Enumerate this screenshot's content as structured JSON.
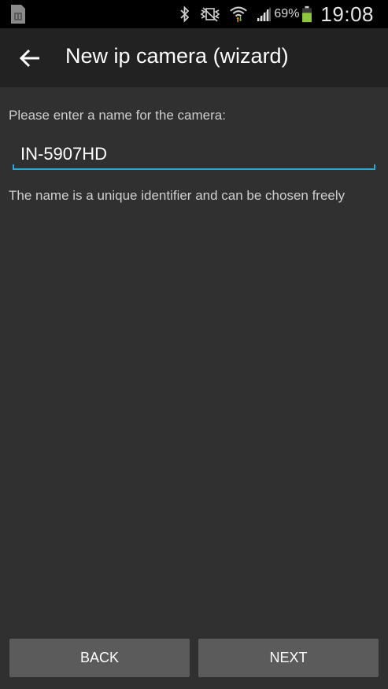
{
  "status_bar": {
    "battery_percent": "69%",
    "time": "19:08",
    "icons": [
      "sim-card-icon",
      "bluetooth-icon",
      "vibrate-icon",
      "wifi-icon",
      "signal-icon",
      "battery-icon"
    ],
    "battery_color": "#8dc63f",
    "wifi_arrow_colors": [
      "#f5a623",
      "#8dc63f"
    ]
  },
  "action_bar": {
    "title": "New ip camera (wizard)",
    "back_icon": "back-arrow-icon"
  },
  "form": {
    "prompt": "Please enter a name for the camera:",
    "name_value": "IN-5907HD",
    "hint": "The name is a unique identifier and can be chosen freely",
    "accent_color": "#2da5cf"
  },
  "buttons": {
    "back_label": "BACK",
    "next_label": "NEXT"
  }
}
